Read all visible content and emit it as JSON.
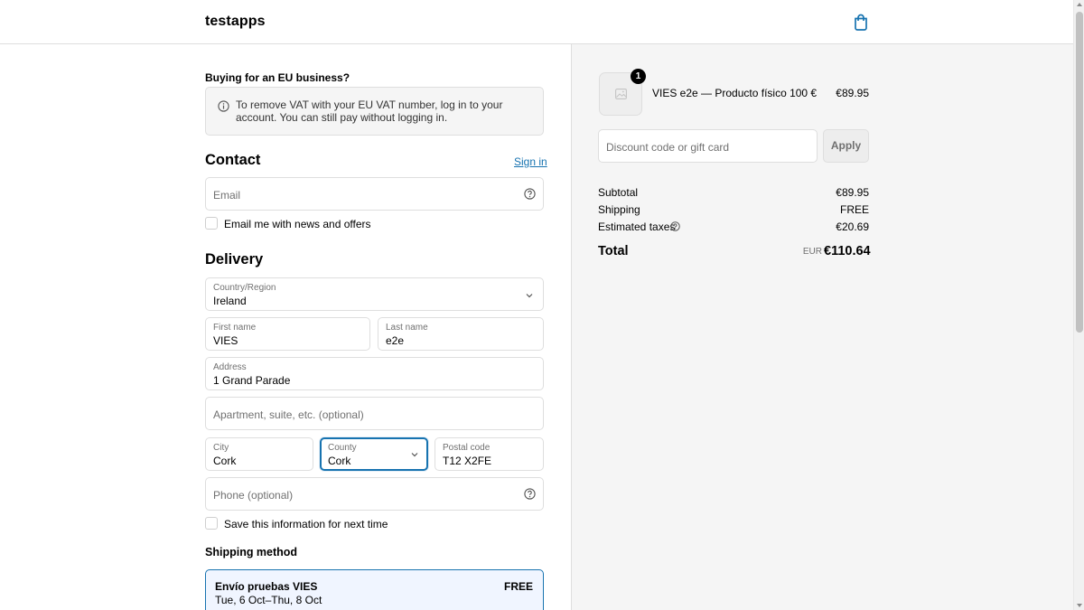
{
  "header": {
    "brand": "testapps",
    "cart_icon": "shopping-bag-icon"
  },
  "eu_notice": {
    "title": "Buying for an EU business?",
    "text": "To remove VAT with your EU VAT number, log in to your account. You can still pay without logging in.",
    "icon": "info-icon"
  },
  "contact": {
    "heading": "Contact",
    "signin_label": "Sign in",
    "email_placeholder": "Email",
    "newsletter_label": "Email me with news and offers"
  },
  "delivery": {
    "heading": "Delivery",
    "country": {
      "label": "Country/Region",
      "value": "Ireland"
    },
    "first_name": {
      "label": "First name",
      "value": "VIES"
    },
    "last_name": {
      "label": "Last name",
      "value": "e2e"
    },
    "address": {
      "label": "Address",
      "value": "1 Grand Parade"
    },
    "apartment_placeholder": "Apartment, suite, etc. (optional)",
    "city": {
      "label": "City",
      "value": "Cork"
    },
    "county": {
      "label": "County",
      "value": "Cork"
    },
    "postal": {
      "label": "Postal code",
      "value": "T12 X2FE"
    },
    "phone_placeholder": "Phone (optional)",
    "save_label": "Save this information for next time"
  },
  "shipping": {
    "heading": "Shipping method",
    "method_name": "Envío pruebas VIES",
    "method_dates": "Tue, 6 Oct–Thu, 8 Oct",
    "method_price": "FREE"
  },
  "summary": {
    "item": {
      "quantity": "1",
      "name": "VIES e2e — Producto físico 100 €",
      "price": "€89.95"
    },
    "discount_placeholder": "Discount code or gift card",
    "apply_label": "Apply",
    "subtotal_label": "Subtotal",
    "subtotal_value": "€89.95",
    "shipping_label": "Shipping",
    "shipping_value": "FREE",
    "taxes_label": "Estimated taxes",
    "taxes_value": "€20.69",
    "total_label": "Total",
    "total_currency": "EUR",
    "total_value": "€110.64"
  },
  "colors": {
    "accent": "#1773b0",
    "summary_bg": "#f5f5f5",
    "border": "#dedede"
  }
}
